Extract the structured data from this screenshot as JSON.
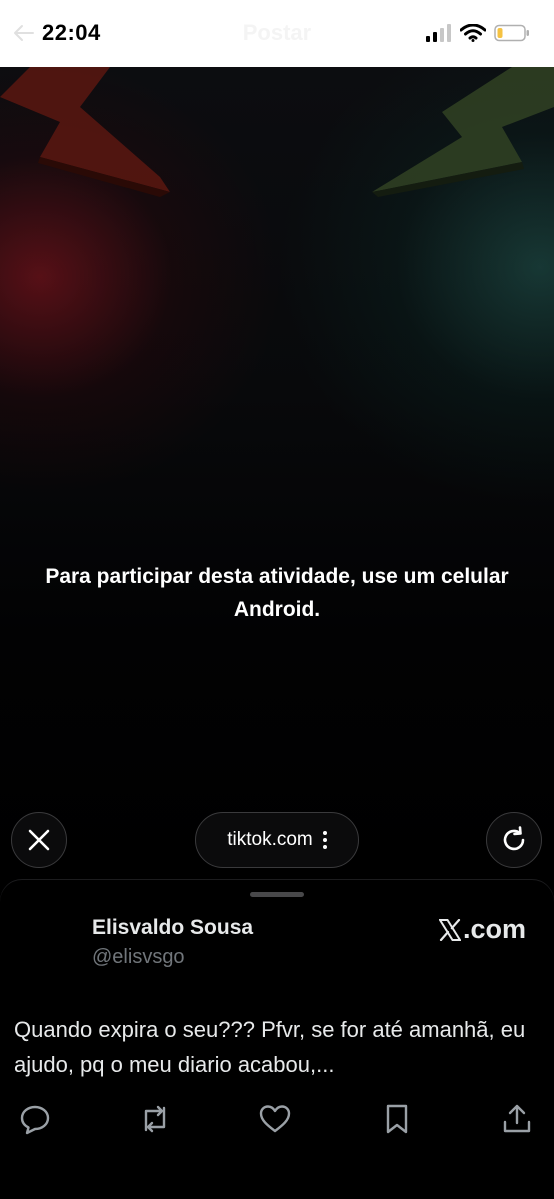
{
  "status_bar": {
    "time": "22:04",
    "title": "Postar",
    "icons": [
      "back-arrow-icon",
      "cellular-signal-icon",
      "wifi-icon",
      "battery-low-icon"
    ]
  },
  "webview": {
    "message": "Para participar desta atividade, use um celular Android."
  },
  "browser_toolbar": {
    "url": "tiktok.com",
    "close_icon": "close-icon",
    "more_icon": "more-vertical-icon",
    "reload_icon": "reload-icon"
  },
  "tweet": {
    "author_name": "Elisvaldo Sousa",
    "author_handle": "@elisvsgo",
    "source_label": ".com",
    "source_icon": "x-logo",
    "text": "Quando expira o seu??? Pfvr, se for até amanhã, eu ajudo, pq o meu diario acabou,...",
    "actions": [
      "reply-icon",
      "retweet-icon",
      "like-icon",
      "bookmark-icon",
      "share-icon"
    ]
  },
  "colors": {
    "background": "#000000",
    "text_primary": "#e7e9ea",
    "text_secondary": "#71767b",
    "red_glow": "#8c1420",
    "teal_glow": "#2a6e64"
  }
}
